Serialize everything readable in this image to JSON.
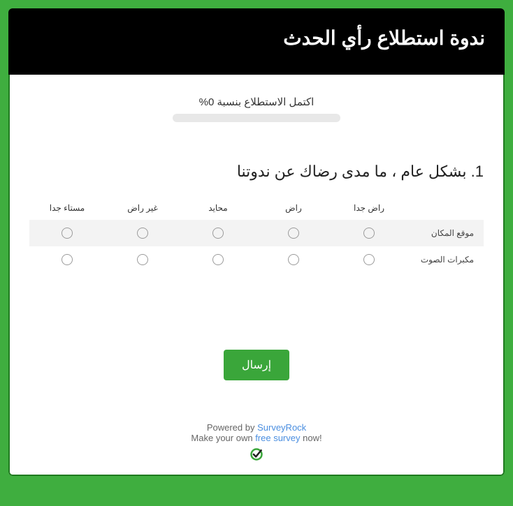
{
  "header": {
    "title": "ندوة استطلاع رأي الحدث"
  },
  "progress": {
    "text": "اكتمل الاستطلاع بنسبة 0%",
    "percent": 0
  },
  "question": {
    "title": "1. بشكل عام ، ما مدى رضاك عن ندوتنا",
    "columns": [
      "راض جدا",
      "راض",
      "محايد",
      "غير راض",
      "مستاء جدا"
    ],
    "rows": [
      "موقع المكان",
      "مكبرات الصوت"
    ]
  },
  "submit": {
    "label": "إرسال"
  },
  "footer": {
    "powered_by_prefix": "Powered by ",
    "powered_by_link": "SurveyRock",
    "make_prefix": "Make your own ",
    "make_link": "free survey",
    "make_suffix": " now!"
  }
}
